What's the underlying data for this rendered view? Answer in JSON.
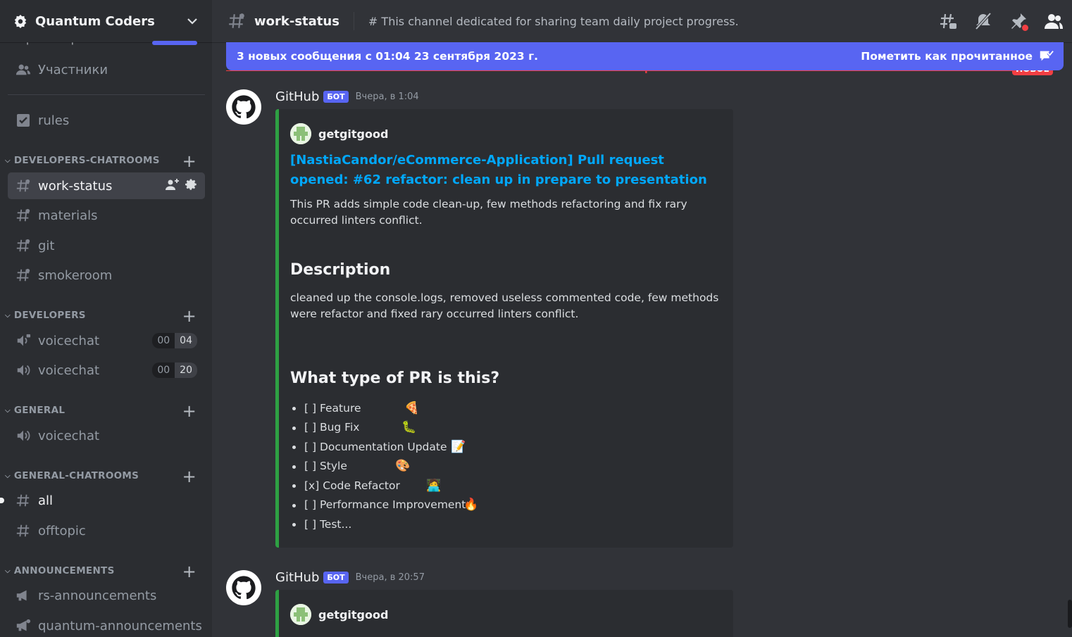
{
  "server": {
    "name": "Quantum Coders",
    "peek_text": "Просмотр каналл..."
  },
  "sidebar": {
    "members_label": "Участники",
    "rules_label": "rules",
    "categories": {
      "dev_chat": "DEVELOPERS-CHATROOMS",
      "developers": "DEVELOPERS",
      "general": "GENERAL",
      "general_chat": "GENERAL-CHATROOMS",
      "announcements": "ANNOUNCEMENTS"
    },
    "channels": {
      "work_status": "work-status",
      "materials": "materials",
      "git": "git",
      "smokeroom": "smokeroom",
      "voice1": {
        "label": "voicechat",
        "count_a": "00",
        "count_b": "04"
      },
      "voice2": {
        "label": "voicechat",
        "count_a": "00",
        "count_b": "20"
      },
      "voice3": "voicechat",
      "all": "all",
      "offtopic": "offtopic",
      "rs_ann": "rs-announcements",
      "quantum_ann": "quantum-announcements"
    }
  },
  "header": {
    "channel": "work-status",
    "topic": "# This channel dedicated for sharing team daily project progress."
  },
  "new_messages": {
    "text": "3 новых сообщения с 01:04 23 сентября 2023 г.",
    "mark_read": "Пометить как прочитанное",
    "date_label": "23 сентября 2023 г.",
    "new_badge": "НОВОЕ"
  },
  "messages": [
    {
      "author": "GitHub",
      "bot_tag": "БОТ",
      "timestamp": "Вчера, в 1:04",
      "embed": {
        "author": "getgitgood",
        "title": "[NastiaCandor/eCommerce-Application] Pull request opened: #62 refactor: clean up in prepare to presentation",
        "summary": "This PR adds simple code clean-up, few methods refactoring and fix rary occurred linters conflict.",
        "description_heading": "Description",
        "description": "cleaned up the console.logs, removed useless commented code, few methods were refactor and fixed rary occurred linters conflict.",
        "pr_type_heading": "What type of PR is this?",
        "pr_types": [
          {
            "label": "[ ] Feature",
            "emoji": "🍕"
          },
          {
            "label": "[ ] Bug Fix",
            "emoji": "🐛"
          },
          {
            "label": "[ ] Documentation Update",
            "emoji": "📝"
          },
          {
            "label": "[ ] Style",
            "emoji": "🎨"
          },
          {
            "label": "[x] Code Refactor",
            "emoji": "🧑‍💻"
          },
          {
            "label": "[ ] Performance Improvements",
            "emoji": "🔥"
          },
          {
            "label": "[ ] Test...",
            "emoji": ""
          }
        ]
      }
    },
    {
      "author": "GitHub",
      "bot_tag": "БОТ",
      "timestamp": "Вчера, в 20:57",
      "embed": {
        "author": "getgitgood"
      }
    }
  ],
  "colors": {
    "accent": "#5865f2",
    "embed_bar": "#2ea043",
    "link": "#00a8fc",
    "alert": "#f23f43"
  }
}
